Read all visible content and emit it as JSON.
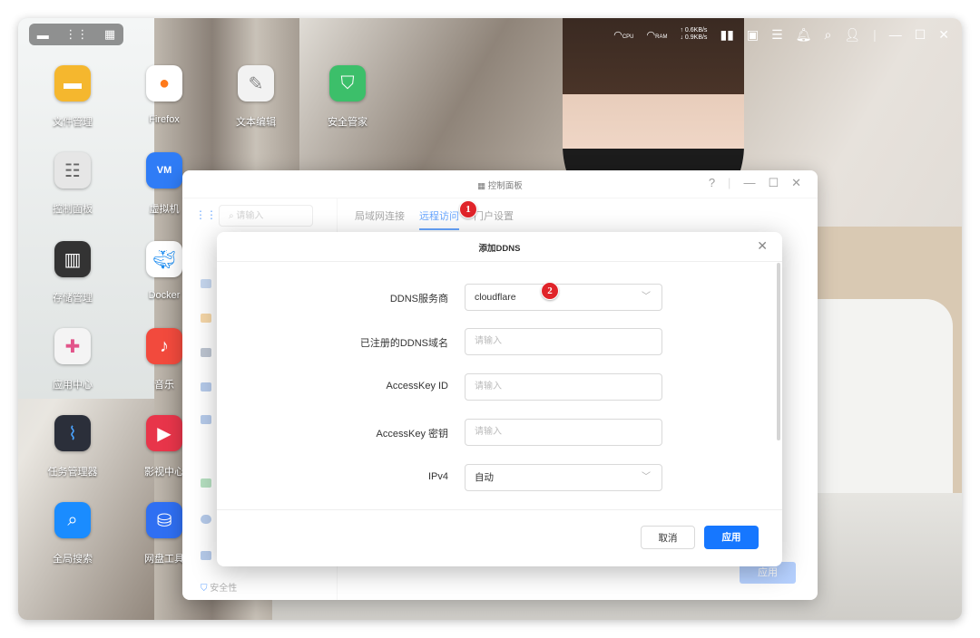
{
  "topbar": {
    "net_up": "↑ 0.6KB/s",
    "net_down": "↓ 0.9KB/s",
    "cpu_label": "CPU",
    "ram_label": "RAM"
  },
  "desktop_icons": [
    {
      "label": "文件管理",
      "icon": "folder-icon",
      "color": "#f5b72e"
    },
    {
      "label": "Firefox",
      "icon": "firefox-icon",
      "color": "#ff7a1a"
    },
    {
      "label": "文本编辑",
      "icon": "text-editor-icon",
      "color": "#f2f2f2"
    },
    {
      "label": "安全管家",
      "icon": "shield-icon",
      "color": "#3cbf6a"
    },
    {
      "label": "控制面板",
      "icon": "control-panel-icon",
      "color": "#e6e6e6"
    },
    {
      "label": "虚拟机",
      "icon": "vm-icon",
      "color": "#2f7cf6"
    },
    {
      "label": "存储管理",
      "icon": "storage-icon",
      "color": "#333333"
    },
    {
      "label": "Docker",
      "icon": "docker-icon",
      "color": "#1d8cf0"
    },
    {
      "label": "应用中心",
      "icon": "app-center-icon",
      "color": "#f4f4f4"
    },
    {
      "label": "音乐",
      "icon": "music-icon",
      "color": "#f24a3d"
    },
    {
      "label": "任务管理器",
      "icon": "task-manager-icon",
      "color": "#2b2f3a"
    },
    {
      "label": "影视中心",
      "icon": "video-center-icon",
      "color": "#e8354a"
    },
    {
      "label": "全局搜索",
      "icon": "search-icon",
      "color": "#1a8cff"
    },
    {
      "label": "网盘工具",
      "icon": "netdisk-icon",
      "color": "#2f6ff2"
    }
  ],
  "control_panel": {
    "title": "控制面板",
    "search_placeholder": "请输入",
    "tabs": [
      "局域网连接",
      "远程访问",
      "门户设置"
    ],
    "active_tab": "远程访问",
    "side_section_label": "安全性",
    "apply_label": "应用"
  },
  "modal": {
    "title": "添加DDNS",
    "fields": [
      {
        "label": "DDNS服务商",
        "value": "cloudflare",
        "type": "select"
      },
      {
        "label": "已注册的DDNS域名",
        "placeholder": "请输入",
        "type": "input"
      },
      {
        "label": "AccessKey ID",
        "placeholder": "请输入",
        "type": "input"
      },
      {
        "label": "AccessKey 密钥",
        "placeholder": "请输入",
        "type": "input"
      },
      {
        "label": "IPv4",
        "value": "自动",
        "type": "select"
      }
    ],
    "cancel_label": "取消",
    "apply_label": "应用"
  },
  "annotations": [
    "1",
    "2"
  ],
  "colors": {
    "accent": "#1677ff",
    "badge": "#e0242a"
  }
}
